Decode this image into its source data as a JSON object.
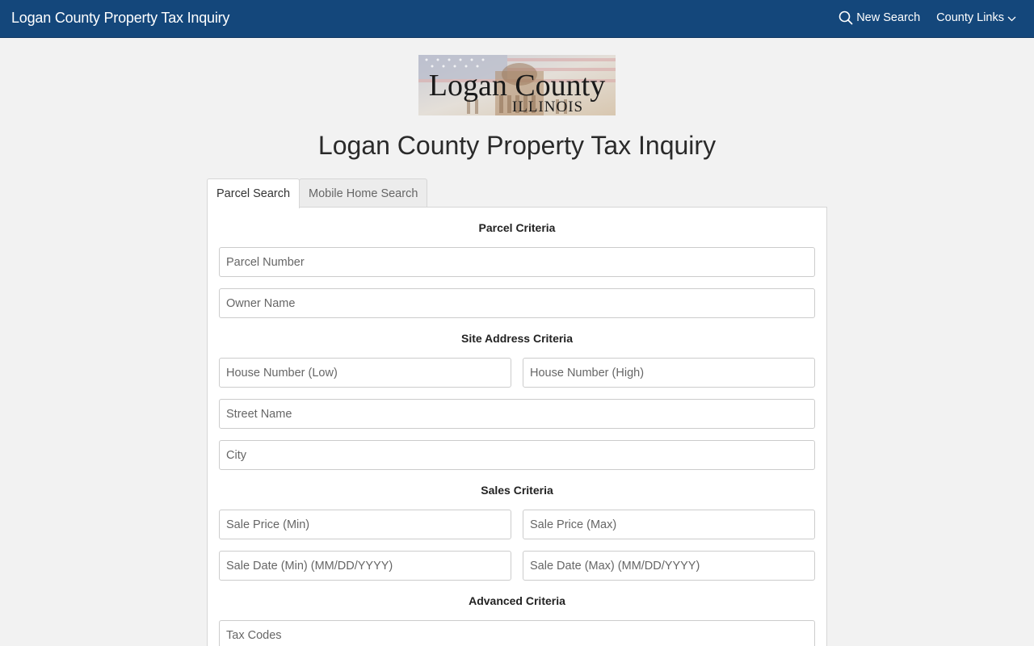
{
  "header": {
    "brand": "Logan County Property Tax Inquiry",
    "new_search": "New Search",
    "county_links": "County Links",
    "icons": {
      "search": "search-icon",
      "dropdown": "chevron-down-icon"
    }
  },
  "logo": {
    "line1": "Logan County",
    "line2": "ILLINOIS"
  },
  "page_title": "Logan County Property Tax Inquiry",
  "tabs": [
    {
      "label": "Parcel Search",
      "active": true
    },
    {
      "label": "Mobile Home Search",
      "active": false
    }
  ],
  "sections": {
    "parcel": {
      "title": "Parcel Criteria",
      "parcel_number": "Parcel Number",
      "owner_name": "Owner Name"
    },
    "site": {
      "title": "Site Address Criteria",
      "house_low": "House Number (Low)",
      "house_high": "House Number (High)",
      "street": "Street Name",
      "city": "City"
    },
    "sales": {
      "title": "Sales Criteria",
      "price_min": "Sale Price (Min)",
      "price_max": "Sale Price (Max)",
      "date_min": "Sale Date (Min) (MM/DD/YYYY)",
      "date_max": "Sale Date (Max) (MM/DD/YYYY)"
    },
    "advanced": {
      "title": "Advanced Criteria",
      "tax_codes": "Tax Codes"
    }
  },
  "colors": {
    "navbar": "#14477b",
    "background": "#f2f2f2"
  }
}
